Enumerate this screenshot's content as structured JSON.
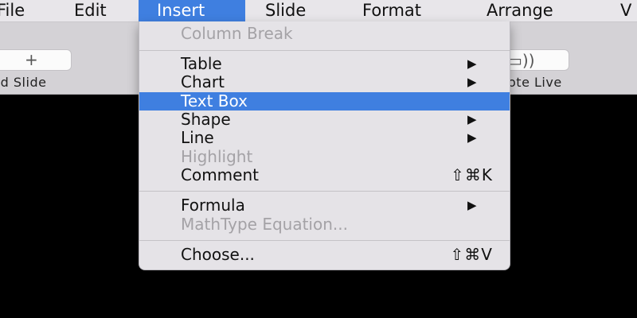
{
  "menubar": {
    "items": [
      "File",
      "Edit",
      "Insert",
      "Slide",
      "Format",
      "Arrange",
      "V"
    ],
    "active_index": 2
  },
  "toolbar": {
    "add_slide": {
      "icon": "plus-icon",
      "glyph": "+",
      "label": "dd Slide"
    },
    "keynote_live": {
      "icon": "keynote-live-icon",
      "glyph": "▭))",
      "label": "ote Live"
    }
  },
  "insert_menu": {
    "items": [
      {
        "label": "Column Break",
        "enabled": false
      },
      {
        "label": "Table",
        "submenu": true,
        "arrow": "▶"
      },
      {
        "label": "Chart",
        "submenu": true,
        "arrow": "▶"
      },
      {
        "label": "Text Box",
        "highlighted": true
      },
      {
        "label": "Shape",
        "submenu": true,
        "arrow": "▶"
      },
      {
        "label": "Line",
        "submenu": true,
        "arrow": "▶"
      },
      {
        "label": "Highlight",
        "enabled": false
      },
      {
        "label": "Comment",
        "shortcut": "⇧⌘K"
      },
      {
        "label": "Formula",
        "submenu": true,
        "arrow": "▶"
      },
      {
        "label": "MathType Equation...",
        "enabled": false
      },
      {
        "label": "Choose...",
        "shortcut": "⇧⌘V"
      }
    ]
  },
  "colors": {
    "menubar_bg": "#e8e6ea",
    "highlight": "#3f7fe0",
    "menu_bg": "#e5e3e7",
    "disabled_text": "#a4a2a6",
    "canvas_bg": "#000000"
  }
}
